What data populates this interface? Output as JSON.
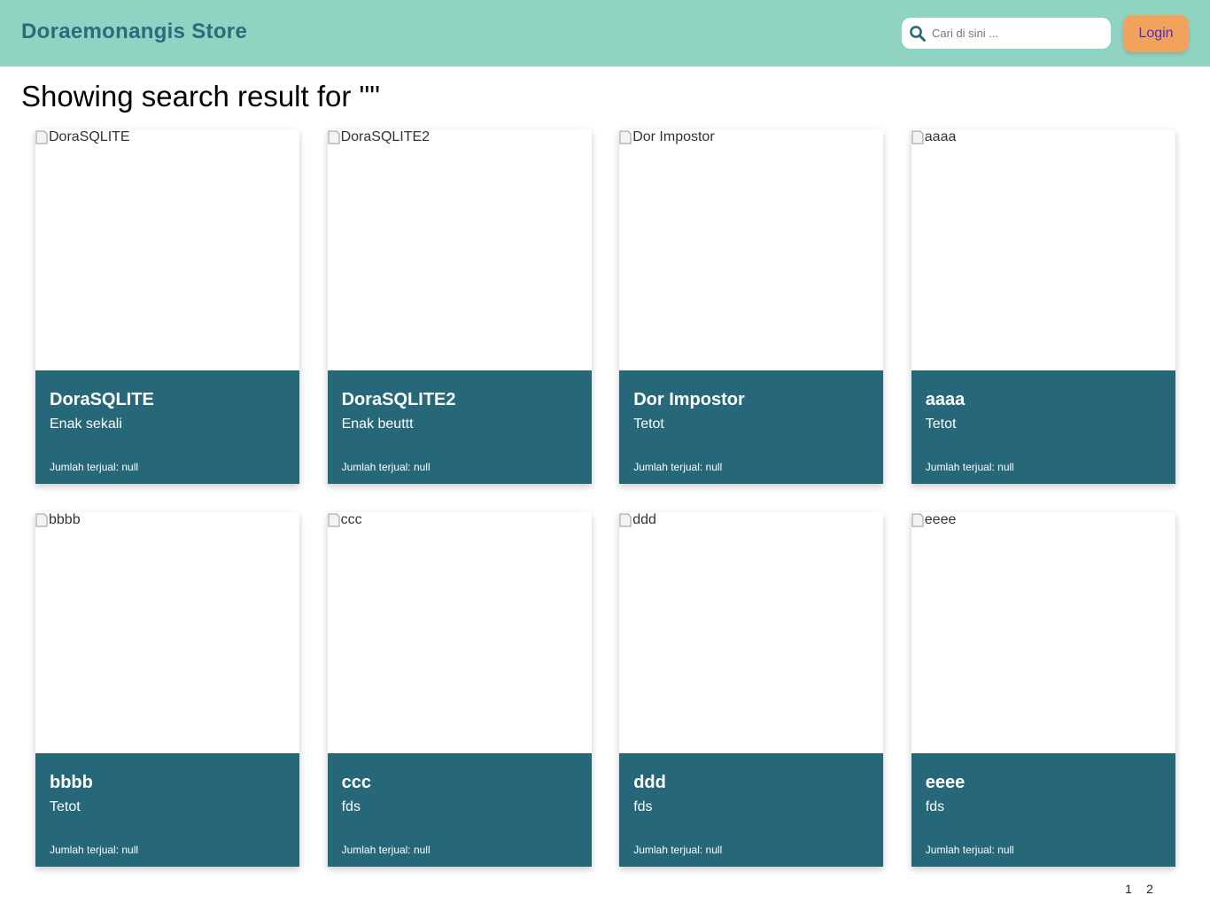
{
  "header": {
    "brand": "Doraemonangis Store",
    "search_placeholder": "Cari di sini ...",
    "login_label": "Login"
  },
  "main": {
    "heading": "Showing search result for \"\""
  },
  "products": [
    {
      "image_alt": "DoraSQLITE",
      "name": "DoraSQLITE",
      "description": "Enak sekali",
      "sold": "Jumlah terjual: null"
    },
    {
      "image_alt": "DoraSQLITE2",
      "name": "DoraSQLITE2",
      "description": "Enak beuttt",
      "sold": "Jumlah terjual: null"
    },
    {
      "image_alt": "Dor Impostor",
      "name": "Dor Impostor",
      "description": "Tetot",
      "sold": "Jumlah terjual: null"
    },
    {
      "image_alt": "aaaa",
      "name": "aaaa",
      "description": "Tetot",
      "sold": "Jumlah terjual: null"
    },
    {
      "image_alt": "bbbb",
      "name": "bbbb",
      "description": "Tetot",
      "sold": "Jumlah terjual: null"
    },
    {
      "image_alt": "ccc",
      "name": "ccc",
      "description": "fds",
      "sold": "Jumlah terjual: null"
    },
    {
      "image_alt": "ddd",
      "name": "ddd",
      "description": "fds",
      "sold": "Jumlah terjual: null"
    },
    {
      "image_alt": "eeee",
      "name": "eeee",
      "description": "fds",
      "sold": "Jumlah terjual: null"
    }
  ],
  "pagination": {
    "pages": [
      "1",
      "2"
    ]
  },
  "colors": {
    "header_bg": "#91d3c3",
    "brand_text": "#2a6b7c",
    "login_bg": "#f2a25c",
    "login_text": "#4a2fc9",
    "card_body_bg": "#266779"
  },
  "icons": {
    "search": "search-icon",
    "broken_image": "broken-image-icon"
  }
}
